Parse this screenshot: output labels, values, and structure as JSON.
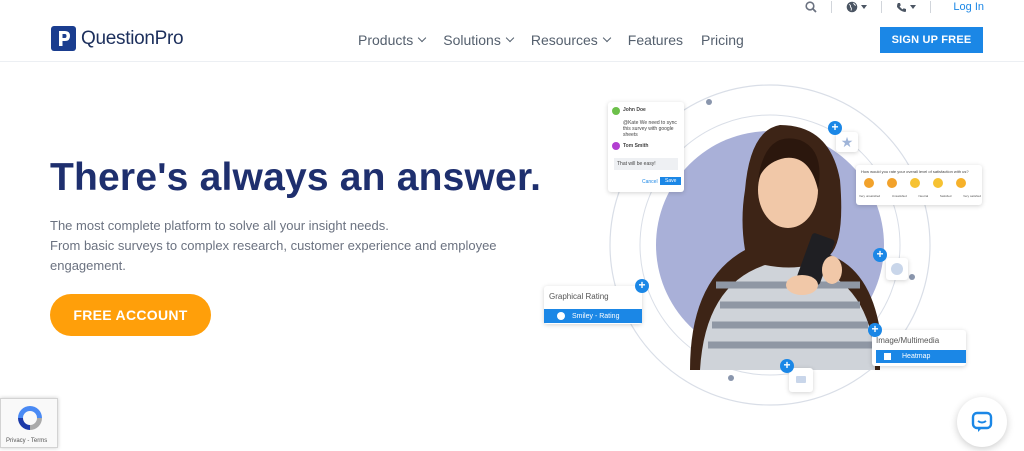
{
  "utility": {
    "login_label": "Log In"
  },
  "brand": {
    "name": "QuestionPro"
  },
  "nav": {
    "items": [
      {
        "label": "Products",
        "dropdown": true
      },
      {
        "label": "Solutions",
        "dropdown": true
      },
      {
        "label": "Resources",
        "dropdown": true
      },
      {
        "label": "Features",
        "dropdown": false
      },
      {
        "label": "Pricing",
        "dropdown": false
      }
    ],
    "signup_label": "SIGN UP FREE"
  },
  "hero": {
    "headline": "There's always an answer.",
    "sub_line1": "The most complete platform to solve all your insight needs.",
    "sub_line2": "From basic surveys to complex research, customer experience and employee engagement.",
    "cta_label": "FREE ACCOUNT"
  },
  "illustration": {
    "chat_card": {
      "user1": "John Doe",
      "user1_msg": "@Kate We need to sync this survey with google sheets",
      "user2": "Tom Smith",
      "user2_msg": "That will be easy!",
      "cancel": "Cancel",
      "save": "Save"
    },
    "rating_card": {
      "question": "How would you rate your overall level of satisfaction with us?",
      "labels": [
        "Very unsatisfied",
        "Unsatisfied",
        "Neutral",
        "Satisfied",
        "Very satisfied"
      ]
    },
    "graphical_rating": {
      "title": "Graphical Rating",
      "button": "Smiley - Rating"
    },
    "image_multimedia": {
      "title": "Image/Multimedia",
      "button": "Heatmap"
    }
  },
  "recaptcha": {
    "text": "Privacy - Terms"
  },
  "colors": {
    "primary": "#1b87e6",
    "navy": "#1e2f6e",
    "cta": "#ff9f0a"
  }
}
